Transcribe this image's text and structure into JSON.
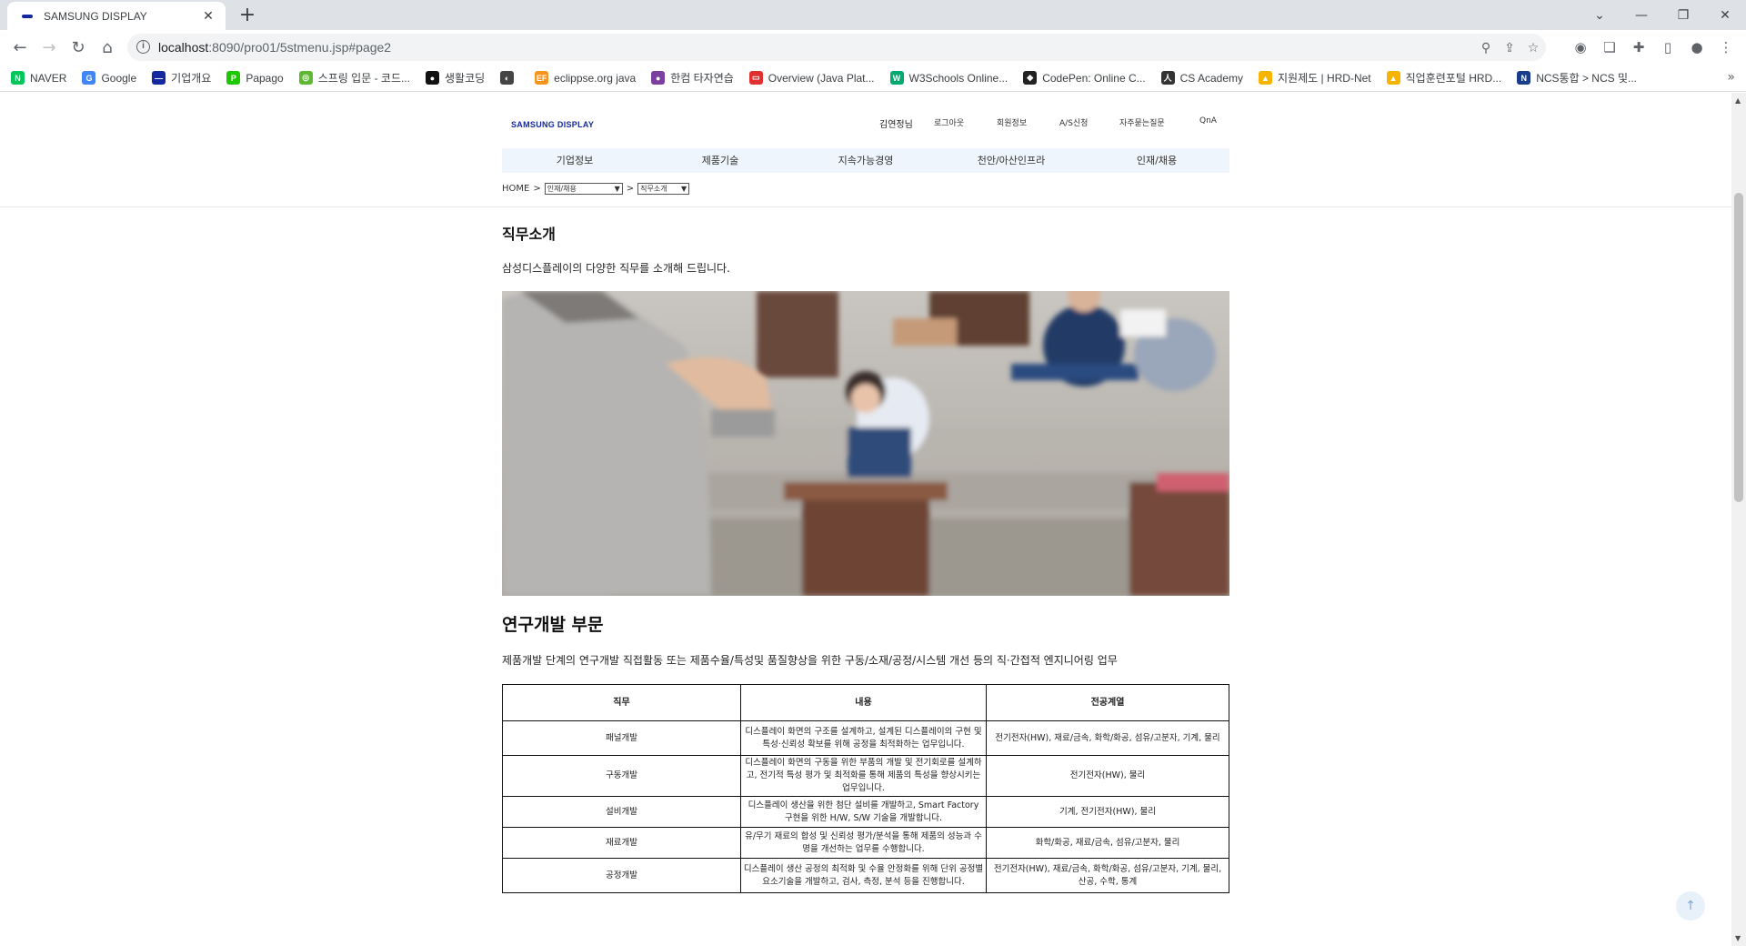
{
  "browser": {
    "tab_title": "SAMSUNG DISPLAY",
    "url_host": "localhost",
    "url_rest": ":8090/pro01/5stmenu.jsp#page2",
    "bookmarks": [
      {
        "label": "NAVER",
        "color": "#03c75a",
        "glyph": "N"
      },
      {
        "label": "Google",
        "color": "#4285f4",
        "glyph": "G"
      },
      {
        "label": "기업개요",
        "color": "#1428a0",
        "glyph": "—"
      },
      {
        "label": "Papago",
        "color": "#1ec800",
        "glyph": "P"
      },
      {
        "label": "스프링 입문 - 코드...",
        "color": "#5fb832",
        "glyph": "◎"
      },
      {
        "label": "생활코딩",
        "color": "#111111",
        "glyph": "●"
      },
      {
        "label": "",
        "color": "#444444",
        "glyph": "◐"
      },
      {
        "label": "eclippse.org java",
        "color": "#f7941e",
        "glyph": "EF"
      },
      {
        "label": "한컴 타자연습",
        "color": "#7b3fa0",
        "glyph": "●"
      },
      {
        "label": "Overview (Java Plat...",
        "color": "#e03030",
        "glyph": "▭"
      },
      {
        "label": "W3Schools Online...",
        "color": "#04aa6d",
        "glyph": "W"
      },
      {
        "label": "CodePen: Online C...",
        "color": "#222222",
        "glyph": "◆"
      },
      {
        "label": "CS Academy",
        "color": "#333333",
        "glyph": "人"
      },
      {
        "label": "지원제도 | HRD-Net",
        "color": "#f5b400",
        "glyph": "▲"
      },
      {
        "label": "직업훈련포털 HRD...",
        "color": "#f5b400",
        "glyph": "▲"
      },
      {
        "label": "NCS통합 > NCS 및...",
        "color": "#1a3c8c",
        "glyph": "N"
      }
    ],
    "bookmark_more": "»"
  },
  "site": {
    "logo": "SAMSUNG DISPLAY",
    "user_greeting": "김연정님",
    "util_links": [
      "로그아웃",
      "회원정보",
      "A/S신청",
      "자주묻는질문",
      "QnA"
    ],
    "gnb": [
      "기업정보",
      "제품기술",
      "지속가능경영",
      "천안/아산인프라",
      "인재/채용"
    ],
    "breadcrumb": {
      "home": "HOME",
      "sep": ">",
      "select1": "인재/채용",
      "select2": "직무소개"
    }
  },
  "main": {
    "title": "직무소개",
    "lead": "삼성디스플레이의 다양한 직무를 소개해 드립니다.",
    "section_title": "연구개발 부문",
    "section_desc": "제품개발 단계의 연구개발 직접활동 또는 제품수율/특성및 품질향상을 위한 구동/소재/공정/시스템 개선 등의 직·간접적 엔지니어링 업무",
    "table": {
      "headers": [
        "직무",
        "내용",
        "전공계열"
      ],
      "rows": [
        [
          "패널개발",
          "디스플레이 화면의 구조를 설계하고, 설계된 디스플레이의 구현 및 특성·신뢰성 확보를 위해 공정을 최적화하는 업무입니다.",
          "전기전자(HW), 재료/금속, 화학/화공, 섬유/고분자, 기계, 물리"
        ],
        [
          "구동개발",
          "디스플레이 화면의 구동을 위한 부품의 개발 및 전기회로를 설계하고, 전기적 특성 평가 및 최적화를 통해 제품의 특성을 향상시키는 업무입니다.",
          "전기전자(HW), 물리"
        ],
        [
          "설비개발",
          "디스플레이 생산을 위한 첨단 설비를 개발하고, Smart Factory 구현을 위한 H/W, S/W 기술을 개발합니다.",
          "기계, 전기전자(HW), 물리"
        ],
        [
          "재료개발",
          "유/무기 재료의 합성 및 신뢰성 평가/분석을 통해 제품의 성능과 수명을 개선하는 업무를 수행합니다.",
          "화학/화공, 재료/금속, 섬유/고분자, 물리"
        ],
        [
          "공정개발",
          "디스플레이 생산 공정의 최적화 및 수율 안정화를 위해 단위 공정별 요소기술을 개발하고, 검사, 측정, 분석 등을 진행합니다.",
          "전기전자(HW), 재료/금속, 화학/화공, 섬유/고분자, 기계, 물리, 산공, 수학, 통계"
        ]
      ]
    },
    "to_top": "↑"
  }
}
